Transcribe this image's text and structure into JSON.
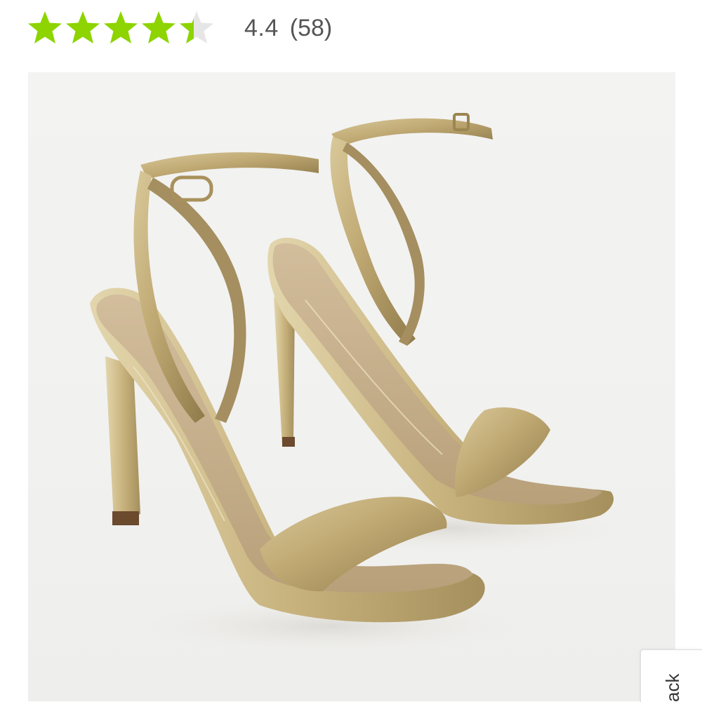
{
  "rating": {
    "stars_filled": 4.4,
    "stars_total": 5,
    "value_text": "4.4",
    "count_text": "(58)",
    "star_color": "#8dd400",
    "star_empty_color": "#e6e6e6"
  },
  "product_image": {
    "icon": "gold-ankle-strap-heeled-sandals",
    "background_color": "#f2f2f0"
  },
  "feedback_tab": {
    "label": "ack"
  }
}
